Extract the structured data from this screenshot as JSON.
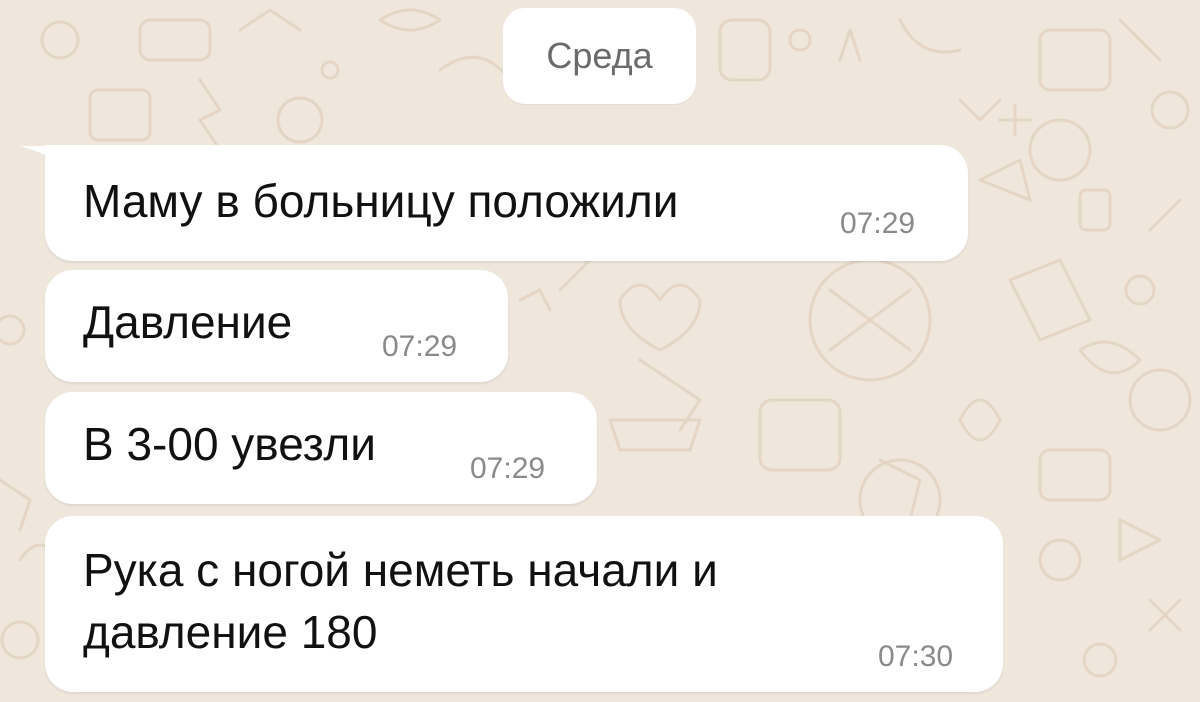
{
  "chat": {
    "date_separator": "Среда",
    "messages": [
      {
        "text": "Маму в больницу положили",
        "time": "07:29"
      },
      {
        "text": "Давление",
        "time": "07:29"
      },
      {
        "text": "В 3-00 увезли",
        "time": "07:29"
      },
      {
        "lines": [
          "Рука с ногой неметь начали и",
          "давление 180"
        ],
        "time": "07:30"
      }
    ]
  },
  "colors": {
    "wallpaper": "#efe7dc",
    "wallpaper_doodle": "#e3d6c4",
    "bubble_incoming": "#ffffff",
    "message_text": "#111111",
    "timestamp_text": "#8a8a8a",
    "date_chip_text": "#6b6b6b"
  }
}
